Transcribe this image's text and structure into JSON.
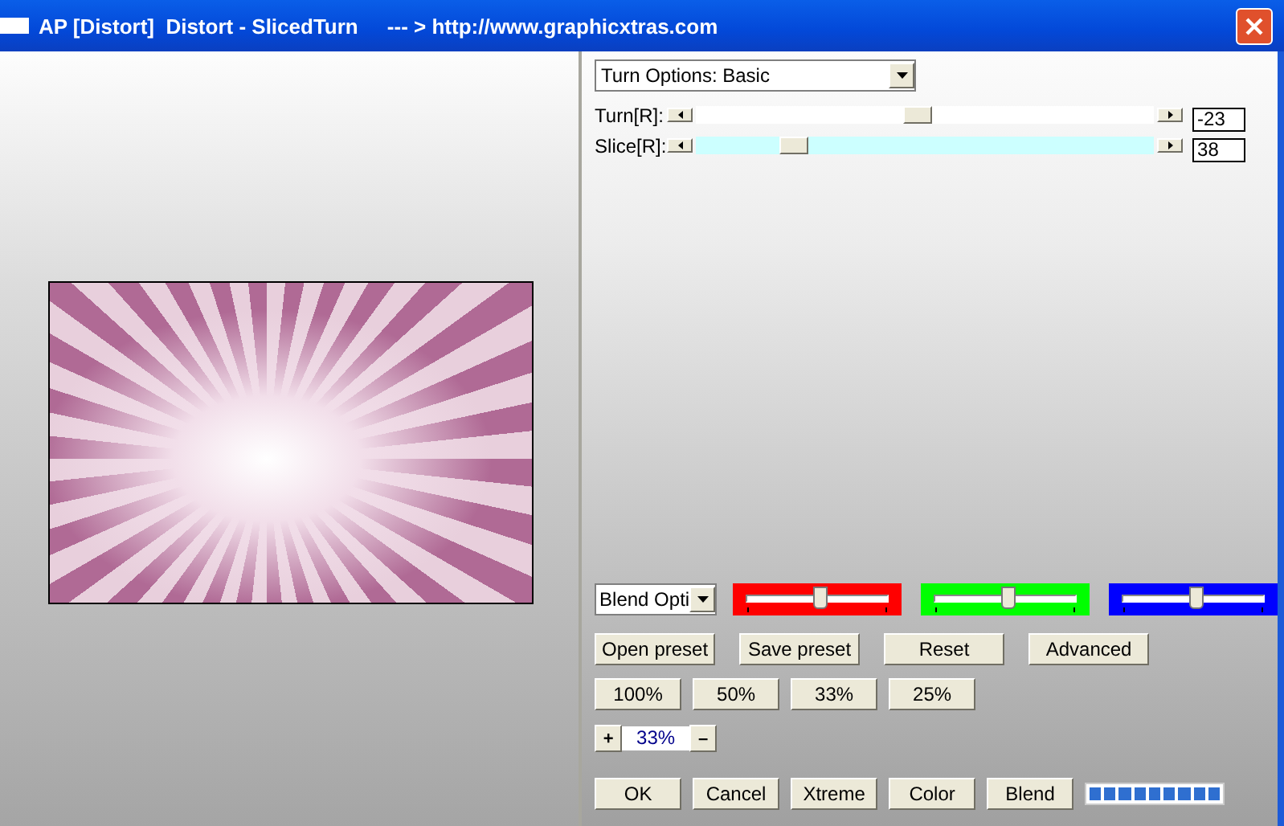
{
  "window": {
    "title": "AP [Distort]  Distort - SlicedTurn     --- > http://www.graphicxtras.com"
  },
  "options_dropdown": {
    "value": "Turn Options: Basic"
  },
  "sliders": [
    {
      "label": "Turn[R]:",
      "level": 0.48,
      "value": "-23",
      "color": "#ffffff"
    },
    {
      "label": "Slice[R]:",
      "level": 0.21,
      "value": "38",
      "color": "#ccffff"
    }
  ],
  "blend_dropdown": {
    "value": "Blend Opti"
  },
  "color_sliders": [
    {
      "color": "#ff0000",
      "level": 0.5
    },
    {
      "color": "#00ff00",
      "level": 0.5
    },
    {
      "color": "#0000ff",
      "level": 0.5
    }
  ],
  "preset_buttons": [
    "Open preset",
    "Save preset",
    "Reset",
    "Advanced"
  ],
  "zoom_buttons": [
    "100%",
    "50%",
    "33%",
    "25%"
  ],
  "zoom_stepper": {
    "plus": "+",
    "value": "33%",
    "minus": "–"
  },
  "action_buttons": [
    "OK",
    "Cancel",
    "Xtreme",
    "Color",
    "Blend"
  ],
  "progress": {
    "level": 1
  }
}
